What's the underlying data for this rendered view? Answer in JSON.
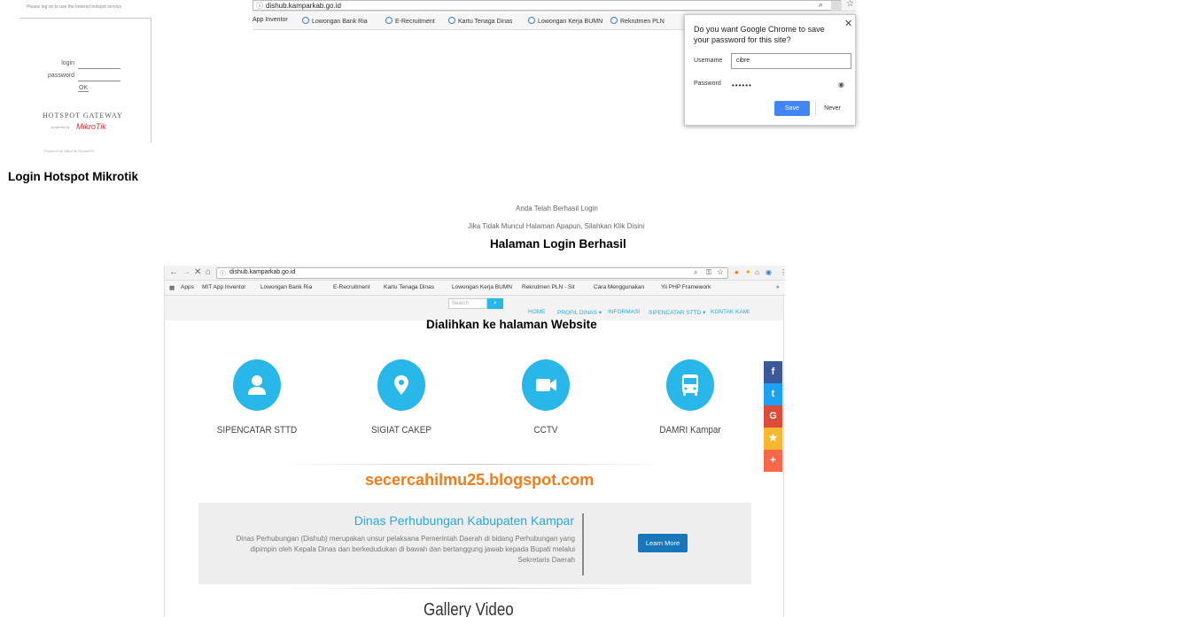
{
  "hotspot": {
    "note": "Please log on to use the Internet hotspot service",
    "login_label": "login",
    "password_label": "password",
    "ok_label": "OK",
    "gateway_title": "HOTSPOT GATEWAY",
    "powered_by": "powered by",
    "brand": "MikroTik",
    "footer": "Powered by MikroTik RouterOS",
    "caption": "Login Hotspot Mikrotik"
  },
  "chrome_save": {
    "url": "dishub.kamparkab.go.id",
    "bookmarks": [
      "App Inventor",
      "Lowongan Bank Ria",
      "E-Recruitment",
      "Kartu Tenaga Dinas",
      "Lowongan Kerja BUMN",
      "Rekrutmen PLN"
    ],
    "popup_question": "Do you want Google Chrome to save your password for this site?",
    "username_label": "Username",
    "username_value": "cibre",
    "password_label": "Password",
    "password_mask": "••••••",
    "save_label": "Save",
    "never_label": "Never"
  },
  "success": {
    "line1": "Anda Telah Berhasil Login",
    "line2": "Jika Tidak Muncul Halaman Apapun, Silahkan Klik Disini",
    "caption": "Halaman Login Berhasil"
  },
  "website": {
    "url": "dishub.kamparkab.go.id",
    "bookmarks": [
      "Apps",
      "MIT App Inventor",
      "Lowongan Bank Ria",
      "E-Recruitment",
      "Kartu Tenaga Dinas",
      "Lowongan Kerja BUMN",
      "Rekrutmen PLN - Sit",
      "Cara Menggunakan",
      "Yii PHP Framework"
    ],
    "search_placeholder": "Search",
    "menu": [
      "HOME",
      "PROFIL DINAS ▾",
      "INFORMASI",
      "SIPENCATAR STTD ▾",
      "KONTAK KAMI"
    ],
    "caption": "Dialihkan ke halaman Website",
    "services": [
      {
        "name": "SIPENCATAR STTD",
        "icon": "user-icon"
      },
      {
        "name": "SIGIAT CAKEP",
        "icon": "map-marker-icon"
      },
      {
        "name": "CCTV",
        "icon": "video-camera-icon"
      },
      {
        "name": "DAMRI Kampar",
        "icon": "bus-icon"
      }
    ],
    "social": [
      {
        "glyph": "f",
        "icon": "facebook-icon",
        "color": "#3b5998"
      },
      {
        "glyph": "t",
        "icon": "twitter-icon",
        "color": "#1da1f2"
      },
      {
        "glyph": "G",
        "icon": "google-icon",
        "color": "#dd4b39"
      },
      {
        "glyph": "★",
        "icon": "star-icon",
        "color": "#f5b731"
      },
      {
        "glyph": "+",
        "icon": "plus-icon",
        "color": "#f7674a"
      }
    ],
    "blog_url": "secercahilmu25.blogspot.com",
    "info_title": "Dinas Perhubungan Kabupaten Kampar",
    "info_body": "Dinas Perhubungan (Dishub) merupakan unsur pelaksana Pemerintah Daerah di bidang Perhubungan yang dipimpin oleh Kepala Dinas dan berkedudukan di bawah dan bertanggung jawab kepada Bupati melalui Sekretaris Daerah",
    "learn_more": "Learn More",
    "gallery_title": "Gallery Video"
  }
}
